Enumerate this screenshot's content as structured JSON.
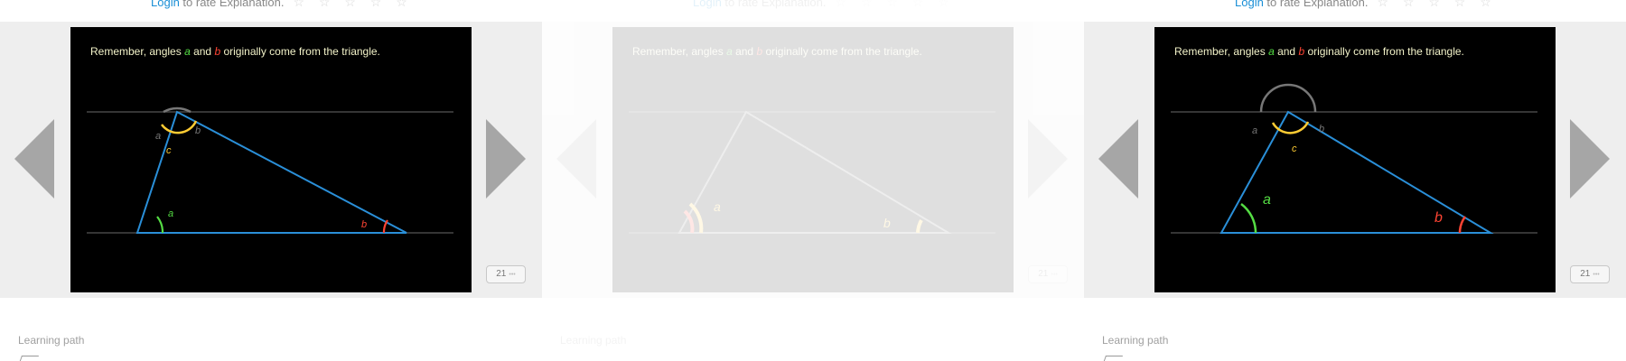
{
  "rating": {
    "login": "Login",
    "text": " to rate Explanation.",
    "stars": "☆ ☆ ☆ ☆ ☆"
  },
  "slide": {
    "prefix": "Remember, angles ",
    "a": "a",
    "mid": " and ",
    "b": "b",
    "suffix": " originally come from the triangle.",
    "label_a": "a",
    "label_b": "b",
    "label_c": "c"
  },
  "counter": {
    "value": "21",
    "dots": "•••"
  },
  "learning_path": "Learning path",
  "colors": {
    "triangle": "#2a8fd8",
    "green": "#55dd44",
    "red": "#ff4433",
    "yellow": "#ffcc33",
    "gray": "#777777"
  }
}
